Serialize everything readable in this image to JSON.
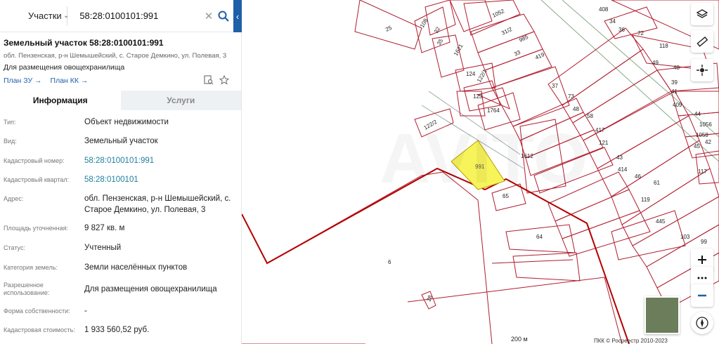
{
  "search": {
    "category": "Участки",
    "query": "58:28:0100101:991"
  },
  "panel": {
    "title": "Земельный участок 58:28:0100101:991",
    "address_line": "обл. Пензенская, р-н Шемышейский, с. Старое Демкино, ул. Полевая, 3",
    "purpose": "Для размещения овощехранилища",
    "links": [
      "План ЗУ →",
      "План КК →"
    ],
    "tabs": [
      "Информация",
      "Услуги"
    ],
    "rows": [
      {
        "label": "Тип:",
        "value": "Объект недвижимости"
      },
      {
        "label": "Вид:",
        "value": "Земельный участок"
      },
      {
        "label": "Кадастровый номер:",
        "value": "58:28:0100101:991"
      },
      {
        "label": "Кадастровый квартал:",
        "value": "58:28:0100101"
      },
      {
        "label": "Адрес:",
        "value": "обл. Пензенская, р-н Шемышейский, с. Старое Демкино, ул. Полевая, 3"
      },
      {
        "label": "Площадь уточненная:",
        "value": "9 827 кв. м"
      },
      {
        "label": "Статус:",
        "value": "Учтенный"
      },
      {
        "label": "Категория земель:",
        "value": "Земли населённых пунктов"
      },
      {
        "label": "Разрешенное использование:",
        "value": "Для размещения овощехранилища"
      },
      {
        "label": "Форма собственности:",
        "value": "-"
      },
      {
        "label": "Кадастровая стоимость:",
        "value": "1 933 560,52 руб."
      }
    ]
  },
  "map": {
    "selected_parcel": "991",
    "parcel_labels": [
      "25",
      "108",
      "32",
      "35",
      "1621",
      "1052",
      "31/2",
      "985",
      "33",
      "419",
      "124",
      "122/1",
      "123",
      "1764",
      "37",
      "73",
      "48",
      "58",
      "417",
      "121",
      "43",
      "414",
      "46",
      "61",
      "119",
      "445",
      "103",
      "99",
      "1612",
      "65",
      "64",
      "6",
      "28",
      "122/2",
      "408",
      "34",
      "36",
      "72",
      "118",
      "49",
      "40",
      "39",
      "41",
      "409",
      "44",
      "1058",
      "45",
      "117",
      "42",
      "1056"
    ],
    "scale_label": "200 м",
    "attribution": "ПКК © Росреестр 2010-2023",
    "controls": [
      "layers-icon",
      "ruler-icon",
      "locate-icon",
      "zoom-in-icon",
      "more-icon",
      "zoom-out-icon",
      "compass-icon"
    ],
    "colors": {
      "parcel_line": "#b01c2e",
      "selected_fill": "#f7f35a",
      "boundary": "#b30000"
    }
  }
}
